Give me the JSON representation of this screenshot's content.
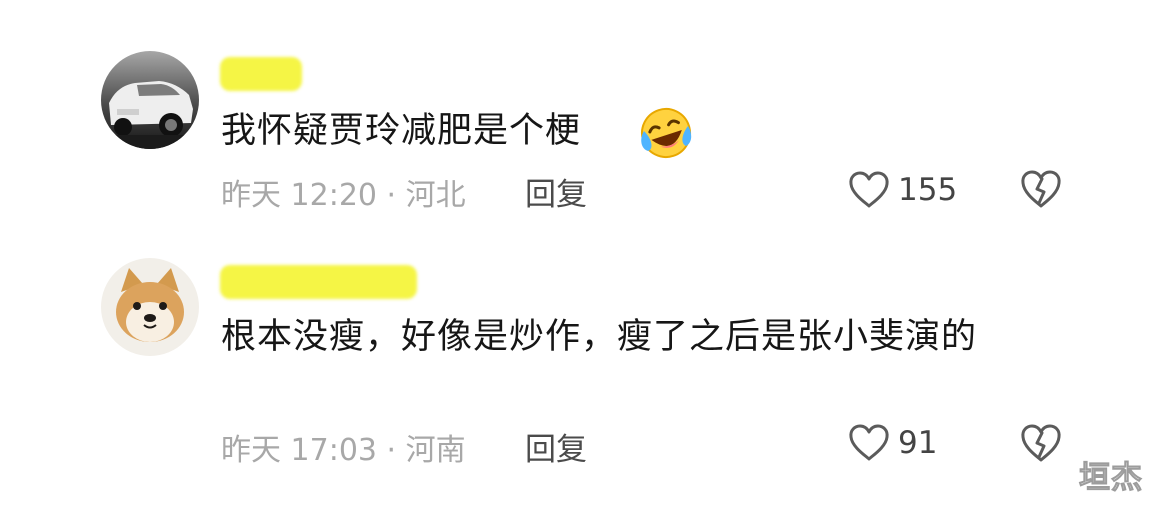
{
  "comments": [
    {
      "avatar": "car-photo-avatar",
      "text": "我怀疑贾玲减肥是个梗",
      "emoji": "laughing-crying-emoji",
      "meta": "昨天 12:20 · 河北",
      "reply_label": "回复",
      "like_count": "155",
      "like_icon": "heart-outline-icon",
      "dislike_icon": "broken-heart-icon"
    },
    {
      "avatar": "shiba-dog-avatar",
      "text": "根本没瘦，好像是炒作，瘦了之后是张小斐演的",
      "meta": "昨天 17:03 · 河南",
      "reply_label": "回复",
      "like_count": "91",
      "like_icon": "heart-outline-icon",
      "dislike_icon": "broken-heart-icon"
    }
  ],
  "watermark": "垣杰",
  "colors": {
    "text": "#161616",
    "meta": "#a8a8a8",
    "highlight": "#f5f545"
  }
}
